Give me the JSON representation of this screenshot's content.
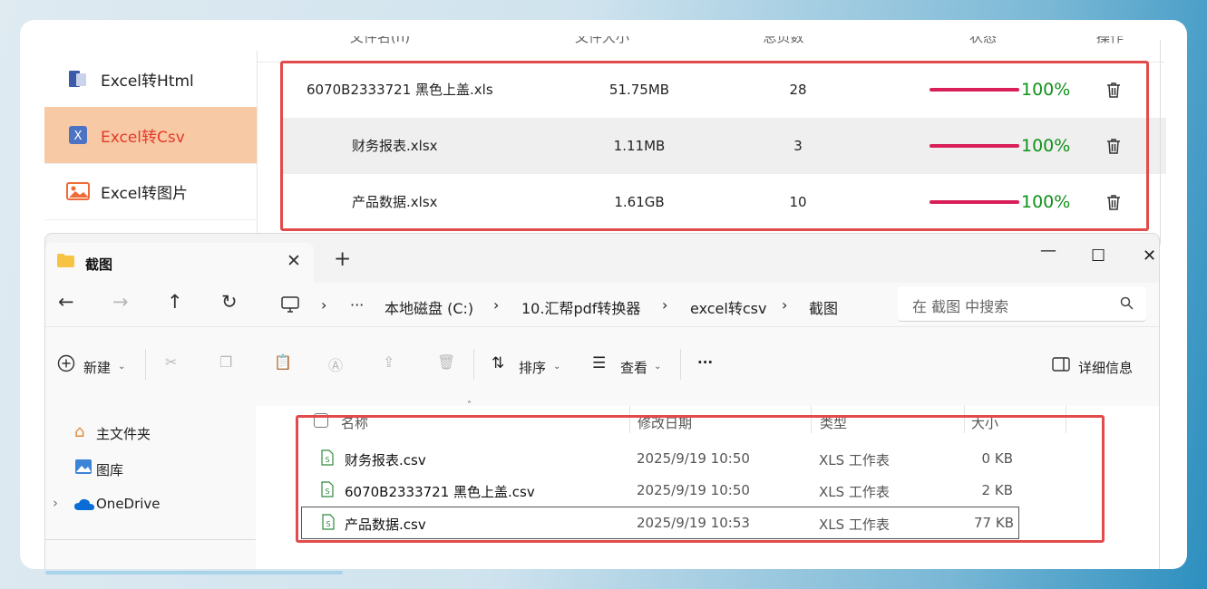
{
  "app": {
    "sidebar": {
      "items": [
        {
          "label": "Excel转Html",
          "icon": "html-file-icon",
          "active": false
        },
        {
          "label": "Excel转Csv",
          "icon": "excel-file-icon",
          "active": true
        },
        {
          "label": "Excel转图片",
          "icon": "image-icon",
          "active": false
        }
      ]
    },
    "table": {
      "columns": [
        "文件名(n)",
        "文件大小",
        "总页数",
        "状态",
        "操作"
      ],
      "rows": [
        {
          "name": "6070B2333721 黑色上盖.xls",
          "size": "51.75MB",
          "pages": "28",
          "progress": 1.0,
          "progress_label": "100%"
        },
        {
          "name": "财务报表.xlsx",
          "size": "1.11MB",
          "pages": "3",
          "progress": 1.0,
          "progress_label": "100%"
        },
        {
          "name": "产品数据.xlsx",
          "size": "1.61GB",
          "pages": "10",
          "progress": 1.0,
          "progress_label": "100%"
        }
      ]
    }
  },
  "explorer": {
    "tab_title": "截图",
    "address": {
      "crumbs": [
        "本地磁盘 (C:)",
        "10.汇帮pdf转换器",
        "excel转csv",
        "截图"
      ]
    },
    "search": {
      "placeholder": "在 截图 中搜索"
    },
    "toolbar": {
      "new_label": "新建",
      "sort_label": "排序",
      "view_label": "查看",
      "more_label": "···",
      "details_label": "详细信息"
    },
    "nav": {
      "items": [
        "主文件夹",
        "图库",
        "OneDrive"
      ]
    },
    "columns": {
      "name": "名称",
      "modified": "修改日期",
      "type": "类型",
      "size": "大小"
    },
    "files": [
      {
        "name": "财务报表.csv",
        "modified": "2025/9/19 10:50",
        "type": "XLS 工作表",
        "size": "0 KB",
        "selected": false
      },
      {
        "name": "6070B2333721 黑色上盖.csv",
        "modified": "2025/9/19 10:50",
        "type": "XLS 工作表",
        "size": "2 KB",
        "selected": false
      },
      {
        "name": "产品数据.csv",
        "modified": "2025/9/19 10:53",
        "type": "XLS 工作表",
        "size": "77 KB",
        "selected": true
      }
    ]
  },
  "colors": {
    "accent_red": "#e24b4b",
    "progress_bar": "#d81f5a",
    "progress_text": "#11911a",
    "active_side_bg": "#f8c9a5"
  }
}
